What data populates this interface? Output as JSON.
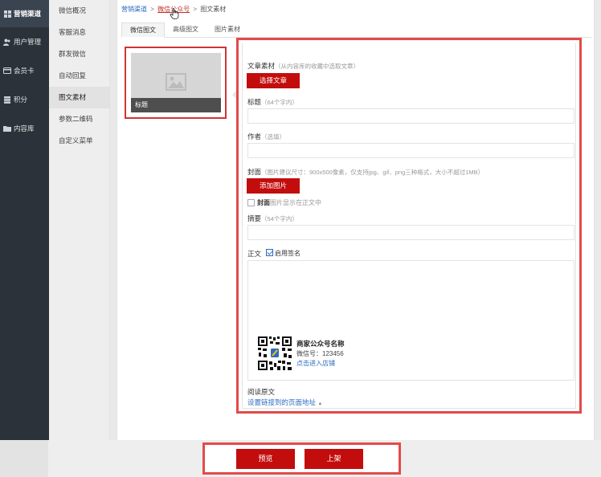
{
  "sidebar": {
    "items": [
      {
        "label": "营销渠道",
        "icon": "grid-icon",
        "active": true
      },
      {
        "label": "用户管理",
        "icon": "users-icon"
      },
      {
        "label": "会员卡",
        "icon": "card-icon"
      },
      {
        "label": "积分",
        "icon": "coins-icon"
      },
      {
        "label": "内容库",
        "icon": "folder-icon"
      }
    ]
  },
  "submenu": {
    "items": [
      {
        "label": "微信概况"
      },
      {
        "label": "客服消息"
      },
      {
        "label": "群发微信"
      },
      {
        "label": "自动回复"
      },
      {
        "label": "图文素材",
        "active": true
      },
      {
        "label": "参数二维码"
      },
      {
        "label": "自定义菜单"
      }
    ]
  },
  "breadcrumb": {
    "level1": "营销渠道",
    "sep": ">",
    "level2": "微信公众号",
    "level3": "图文素材"
  },
  "tabs": [
    {
      "label": "微信图文",
      "active": true
    },
    {
      "label": "高级图文"
    },
    {
      "label": "图片素材"
    }
  ],
  "card": {
    "caption": "标题"
  },
  "form": {
    "material_label": "文章素材",
    "material_hint": "（从内容库的收藏中选取文章）",
    "select_button": "选择文章",
    "title_label": "标题",
    "title_hint": "（64个字内）",
    "author_label": "作者",
    "author_hint": "（选填）",
    "cover_label": "封面",
    "cover_hint": "（图片建议尺寸：900x500像素，仅支持jpg、gif、png三种格式，大小不超过1MB）",
    "add_image_button": "添加图片",
    "cover_show_bold": "封面",
    "cover_show_text": "图片显示在正文中",
    "summary_label": "摘要",
    "summary_hint": "（54个字内）",
    "body_label": "正文",
    "signature_label": "启用签名",
    "read_original_label": "阅读原文",
    "set_link": "设置链接到的页面地址",
    "set_link_arrow": "▲"
  },
  "signature": {
    "name": "商家公众号名称",
    "wechat_id": "微信号：123456",
    "link": "点击进入店铺"
  },
  "footer": {
    "preview_button": "预览",
    "publish_button": "上架"
  },
  "colors": {
    "accent_red": "#c30d0d",
    "highlight_red": "#e34a4a",
    "link_blue": "#2d6cc0",
    "sidebar_dark": "#2b323a"
  }
}
